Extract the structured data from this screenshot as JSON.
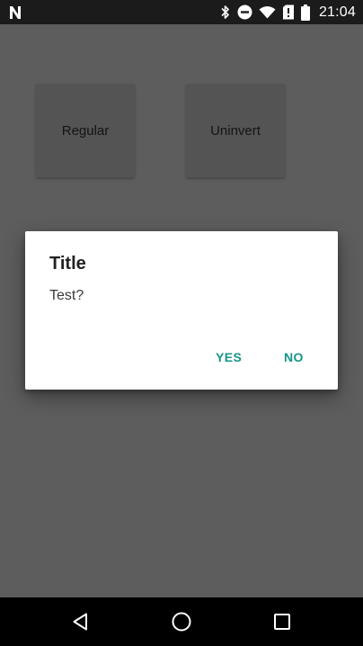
{
  "status_bar": {
    "time": "21:04",
    "icons": [
      "notification-n-icon",
      "bluetooth-icon",
      "do-not-disturb-icon",
      "wifi-icon",
      "no-sim-icon",
      "battery-icon"
    ]
  },
  "main": {
    "buttons": [
      {
        "label": "Regular"
      },
      {
        "label": "Uninvert"
      }
    ]
  },
  "dialog": {
    "title": "Title",
    "message": "Test?",
    "positive": "YES",
    "negative": "NO",
    "accent_color": "#149688"
  },
  "nav_bar": {
    "icons": [
      "back-icon",
      "home-icon",
      "recents-icon"
    ]
  },
  "colors": {
    "scrim_background": "#5d5d5d",
    "status_bar": "#1b1b1b",
    "nav_bar": "#000000"
  }
}
